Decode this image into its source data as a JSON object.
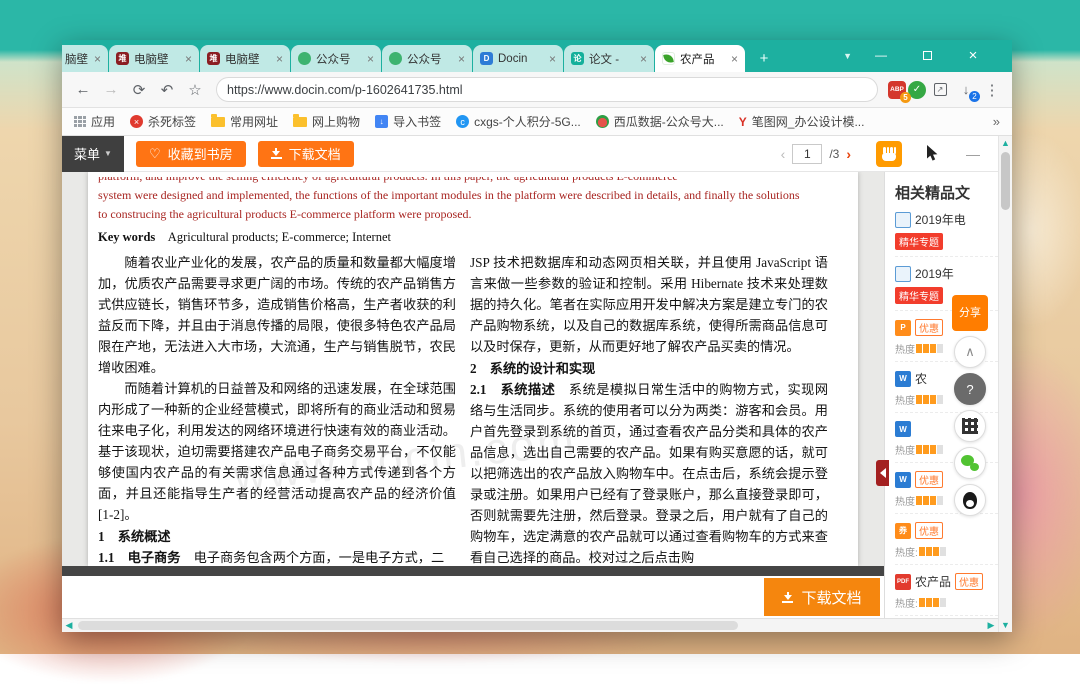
{
  "theme": {
    "browser_teal": "#1db0a0",
    "docin_orange": "#ff7414",
    "badge_red": "#f23d2c",
    "document_red_text": "#a82622"
  },
  "browser": {
    "tabs": [
      {
        "label": "脑壁",
        "icon": "duitang-favicon"
      },
      {
        "label": "电脑壁",
        "icon": "duitang-favicon"
      },
      {
        "label": "电脑壁",
        "icon": "duitang-favicon"
      },
      {
        "label": "公众号",
        "icon": "green-favicon"
      },
      {
        "label": "公众号",
        "icon": "green-favicon"
      },
      {
        "label": "Docin",
        "icon": "docin-blue-favicon"
      },
      {
        "label": "论文 -",
        "icon": "teal-favicon"
      },
      {
        "label": "农产品",
        "icon": "docin-leaf-favicon",
        "active": true
      }
    ],
    "new_tab": "+",
    "tab_close": "×",
    "window_controls": {
      "minimize": "—",
      "close": "×"
    },
    "nav": {
      "back": "←",
      "forward": "→",
      "refresh": "⟳",
      "undo": "↶",
      "star": "☆"
    },
    "address": {
      "url": "https://www.docin.com/p-1602641735.html",
      "abp_label": "ABP",
      "abp_badge": "5",
      "check_icon": "✓",
      "panel_icon": "↗",
      "download_badge": "2",
      "menu_icon": "⋮"
    },
    "bookmarks": {
      "apps_label": "应用",
      "items": [
        "杀死标签",
        "常用网址",
        "网上购物",
        "导入书签",
        "cxgs-个人积分-5G...",
        "西瓜数据-公众号大...",
        "笔图网_办公设计模..."
      ],
      "overflow": "»"
    }
  },
  "viewer": {
    "menu_label": "菜单",
    "favorite_label": "收藏到书房",
    "download_label": "下载文档",
    "page_prev": "‹",
    "page_current": "1",
    "page_total": "/3",
    "page_next": "›",
    "toolbar_collapse": "—",
    "footer_download_label": "下载文档"
  },
  "document": {
    "clipped_line": "platform, and improve the selling efficiency of agricultural products. In this paper, the agricultural products E-commerce",
    "line2": "system were designed and implemented, the functions of the important modules in the platform were described in details, and finally the solutions",
    "line3": "to construcing the agricultural products E-commerce platform were proposed.",
    "keywords_label": "Key words",
    "keywords_text": "　Agricultural products; E-commerce; Internet",
    "left_col": {
      "p1": "随着农业产业化的发展，农产品的质量和数量都大幅度增加，优质农产品需要寻求更广阔的市场。传统的农产品销售方式供应链长，销售环节多，造成销售价格高，生产者收获的利益反而下降，并且由于消息传播的局限，使很多特色农产品局限在产地，无法进入大市场，大流通，生产与销售脱节，农民增收困难。",
      "p2": "而随着计算机的日益普及和网络的迅速发展，在全球范围内形成了一种新的企业经营模式，即将所有的商业活动和贸易往来电子化，利用发达的网络环境进行快速有效的商业活动。基于该现状，迫切需要搭建农产品电子商务交易平台，不仅能够使国内农产品的有关需求信息通过各种方式传递到各个方面，并且还能指导生产者的经营活动提高农产品的经济价值[1-2]。",
      "h1": "1　系统概述",
      "p3_label": "1.1　电子商务",
      "p3_text": "　电子商务包含两个方面，一是电子方式，二"
    },
    "right_col": {
      "p1": "JSP 技术把数据库和动态网页相关联，并且使用 JavaScript 语言来做一些参数的验证和控制。采用 Hibernate 技术来处理数据的持久化。笔者在实际应用开发中解决方案是建立专门的农产品购物系统，以及自己的数据库系统，使得所需商品信息可以及时保存，更新，从而更好地了解农产品买卖的情况。",
      "h1": "2　系统的设计和实现",
      "p2_label": "2.1　系统描述",
      "p2_text": "　系统是模拟日常生活中的购物方式，实现网络与生活同步。系统的使用者可以分为两类：游客和会员。用户首先登录到系统的首页，通过查看农产品分类和具体的农产品信息，选出自己需要的农产品。如果有购买意愿的话，就可以把筛选出的农产品放入购物车中。在点击后，系统会提示登录或注册。如果用户已经有了登录账户，那么直接登录即可，否则就需要先注册，然后登录。登录之后，用户就有了自己的购物车，选定满意的农产品就可以通过查看购物车的方式来查看自己选择的商品。校对过之后点击购"
    },
    "watermark": "www.docin.com"
  },
  "sidebar": {
    "title": "相关精品文",
    "heat_label": "热度",
    "items": [
      {
        "icon": "doc-icon",
        "title": "2019年电",
        "badge": "精华专题"
      },
      {
        "icon": "doc-icon",
        "title": "2019年",
        "badge": "精华专题"
      },
      {
        "icon": "p-icon",
        "title": "",
        "tag": "优惠",
        "heat": "热度"
      },
      {
        "icon": "word-icon",
        "title": "农",
        "heat": "热度"
      },
      {
        "icon": "word-icon",
        "title": "",
        "heat": "热度"
      },
      {
        "icon": "word-icon",
        "title": "",
        "tag": "优惠",
        "heat": "热度"
      },
      {
        "icon": "coupon-icon",
        "title": "",
        "tag": "优惠",
        "heat": "热度:"
      },
      {
        "icon": "pdf-icon",
        "title": "农产品",
        "tag": "优惠",
        "heat": "热度:"
      }
    ]
  },
  "floating": {
    "share": "分享",
    "collapse": "∧",
    "help": "?"
  }
}
